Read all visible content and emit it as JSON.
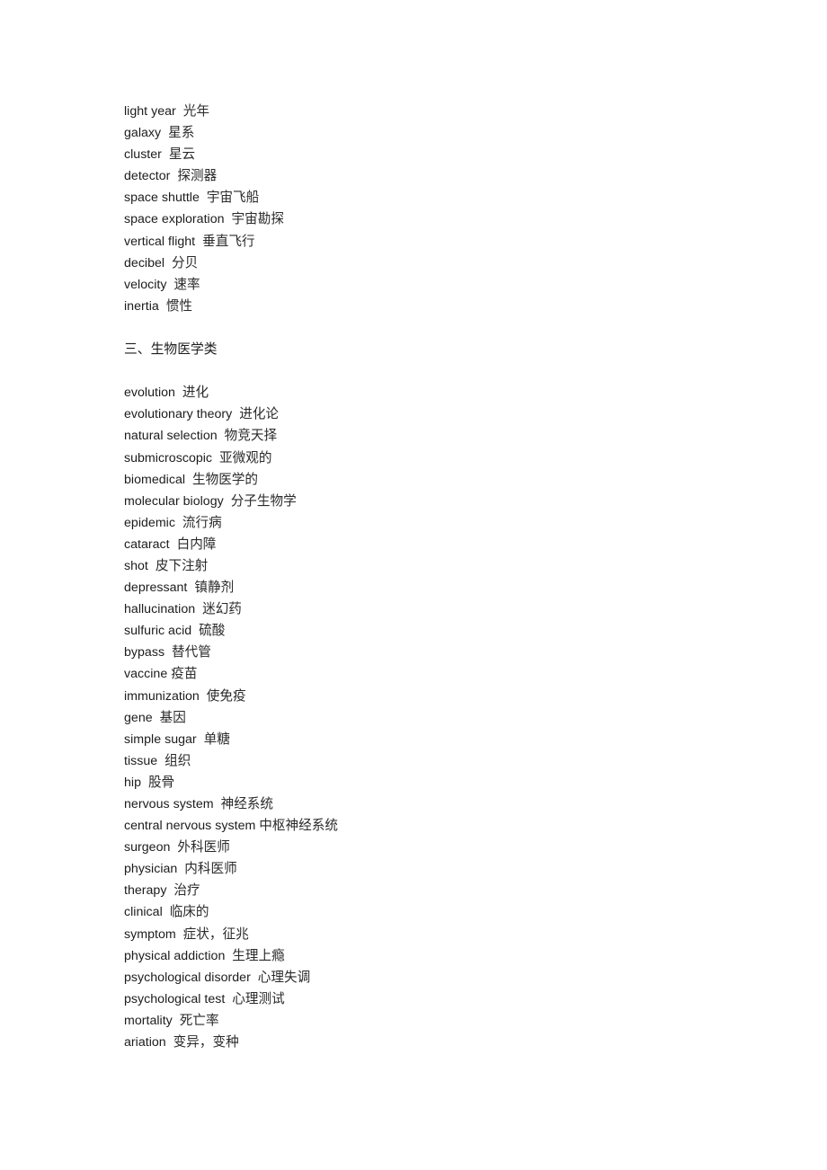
{
  "document": {
    "background_color": "#ffffff",
    "text_color": "#1c1c1c",
    "blocks": [
      {
        "type": "entry-list",
        "name": "astronomy-physics-entries",
        "entries": [
          {
            "term": "light year",
            "gloss": "光年"
          },
          {
            "term": "galaxy",
            "gloss": "星系"
          },
          {
            "term": "cluster",
            "gloss": "星云"
          },
          {
            "term": "detector",
            "gloss": "探测器"
          },
          {
            "term": "space shuttle",
            "gloss": "宇宙飞船"
          },
          {
            "term": "space exploration",
            "gloss": "宇宙勘探"
          },
          {
            "term": "vertical flight",
            "gloss": "垂直飞行"
          },
          {
            "term": "decibel",
            "gloss": "分贝"
          },
          {
            "term": "velocity",
            "gloss": "速率"
          },
          {
            "term": "inertia",
            "gloss": "惯性"
          }
        ]
      },
      {
        "type": "spacer",
        "name": "blank-line-before-heading"
      },
      {
        "type": "heading",
        "name": "section-heading-biomedical",
        "text": "三、生物医学类"
      },
      {
        "type": "spacer",
        "name": "blank-line-after-heading"
      },
      {
        "type": "entry-list",
        "name": "biomedical-entries",
        "entries": [
          {
            "term": "evolution",
            "gloss": "进化"
          },
          {
            "term": "evolutionary theory",
            "gloss": "进化论"
          },
          {
            "term": "natural selection",
            "gloss": "物竞天择"
          },
          {
            "term": "submicroscopic",
            "gloss": "亚微观的"
          },
          {
            "term": "biomedical",
            "gloss": "生物医学的"
          },
          {
            "term": "molecular biology",
            "gloss": "分子生物学"
          },
          {
            "term": "epidemic",
            "gloss": "流行病"
          },
          {
            "term": "cataract",
            "gloss": "白内障"
          },
          {
            "term": "shot",
            "gloss": "皮下注射"
          },
          {
            "term": "depressant",
            "gloss": "镇静剂"
          },
          {
            "term": "hallucination",
            "gloss": "迷幻药"
          },
          {
            "term": "sulfuric acid",
            "gloss": "硫酸"
          },
          {
            "term": "bypass",
            "gloss": "替代管"
          },
          {
            "term": "vaccine",
            "gloss": "疫苗",
            "gap": "thin"
          },
          {
            "term": "immunization",
            "gloss": "使免疫"
          },
          {
            "term": "gene",
            "gloss": "基因"
          },
          {
            "term": "simple sugar",
            "gloss": "单糖"
          },
          {
            "term": "tissue",
            "gloss": "组织"
          },
          {
            "term": "hip",
            "gloss": "股骨"
          },
          {
            "term": "nervous system",
            "gloss": "神经系统"
          },
          {
            "term": "central nervous system",
            "gloss": "中枢神经系统",
            "gap": "none"
          },
          {
            "term": "surgeon",
            "gloss": "外科医师"
          },
          {
            "term": "physician",
            "gloss": "内科医师"
          },
          {
            "term": "therapy",
            "gloss": "治疗"
          },
          {
            "term": "clinical",
            "gloss": "临床的"
          },
          {
            "term": "symptom",
            "gloss": "症状，征兆"
          },
          {
            "term": "physical addiction",
            "gloss": "生理上瘾"
          },
          {
            "term": "psychological disorder",
            "gloss": "心理失调"
          },
          {
            "term": "psychological test",
            "gloss": "心理测试"
          },
          {
            "term": "mortality",
            "gloss": "死亡率"
          },
          {
            "term": "ariation",
            "gloss": "变异，变种"
          }
        ]
      }
    ]
  }
}
